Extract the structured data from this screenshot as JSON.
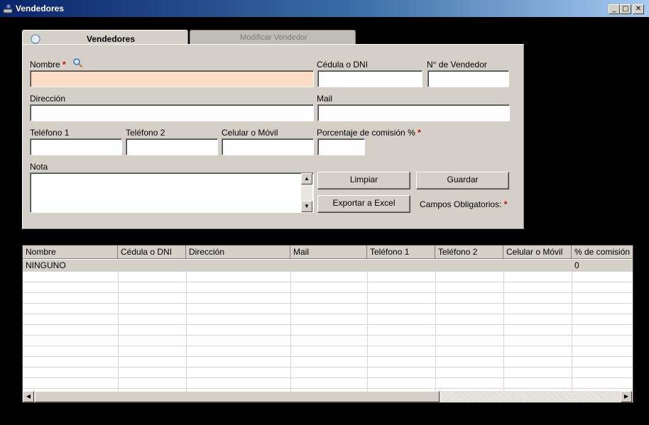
{
  "window": {
    "title": "Vendedores",
    "minimize": "_",
    "maximize": "□",
    "close": "✕"
  },
  "tabs": {
    "active": "Vendedores",
    "inactive": "Modificar Vendedor"
  },
  "form": {
    "nombre_label": "Nombre",
    "required_mark": "*",
    "cedula_label": "Cédula o DNI",
    "nro_vendedor_label": "N° de Vendedor",
    "direccion_label": "Dirección",
    "mail_label": "Mail",
    "telefono1_label": "Teléfono 1",
    "telefono2_label": "Teléfono 2",
    "celular_label": "Celular o Móvil",
    "comision_label": "Porcentaje de comisión %",
    "nota_label": "Nota",
    "nombre_value": "",
    "cedula_value": "",
    "nro_vendedor_value": "",
    "direccion_value": "",
    "mail_value": "",
    "telefono1_value": "",
    "telefono2_value": "",
    "celular_value": "",
    "comision_value": "",
    "nota_value": ""
  },
  "buttons": {
    "limpiar": "Limpiar",
    "guardar": "Guardar",
    "exportar": "Exportar a Excel"
  },
  "legend": {
    "campos_obligatorios": "Campos Obligatorios:"
  },
  "grid": {
    "columns": [
      "Nombre",
      "Cédula o DNI",
      "Dirección",
      "Mail",
      "Teléfono 1",
      "Teléfono 2",
      "Celular o Móvil",
      "% de comisión"
    ],
    "rows": [
      [
        "NINGUNO",
        "",
        "",
        "",
        "",
        "",
        "",
        "0"
      ]
    ]
  },
  "colors": {
    "nombre_field_bg": "#fcdcc4",
    "required": "#d00000",
    "selected_row_bg": "#d4d0c8"
  },
  "icons": [
    "app-icon",
    "user-icon",
    "search-icon"
  ]
}
